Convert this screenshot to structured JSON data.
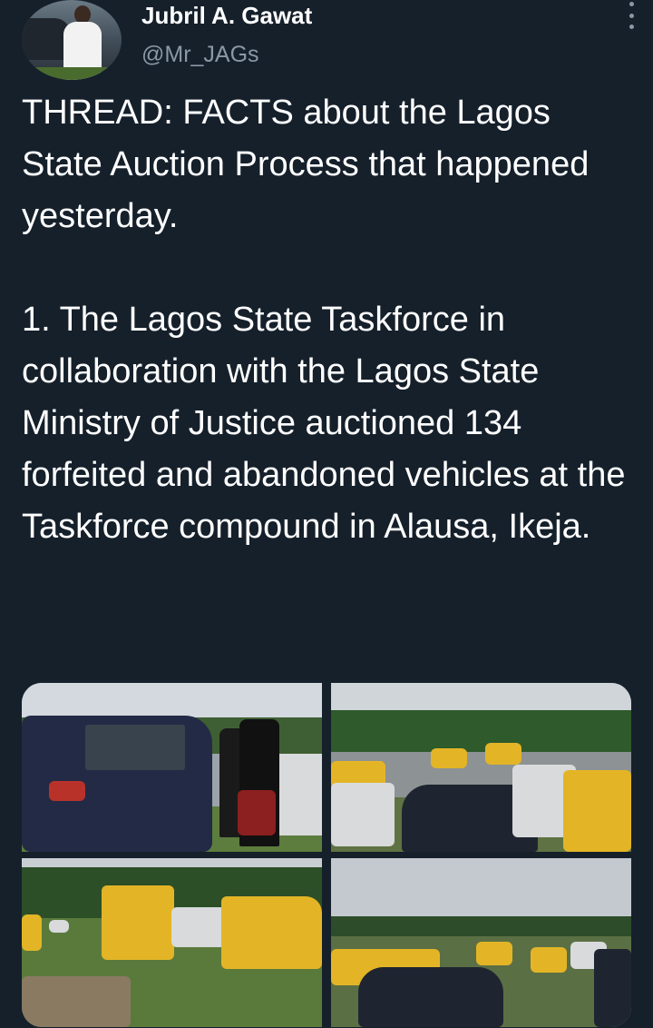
{
  "author": {
    "name": "Jubril A. Gawat",
    "handle": "@Mr_JAGs"
  },
  "tweet": {
    "paragraph1": "THREAD: FACTS about the Lagos State Auction Process that happened yesterday.",
    "paragraph2": "1. The Lagos State Taskforce in collaboration with the Lagos State Ministry of Justice auctioned 134 forfeited and abandoned vehicles at the Taskforce compound in Alausa, Ikeja."
  },
  "media": {
    "count": 4,
    "photos": [
      "Vehicles at auction 1",
      "Vehicles at auction 2",
      "Vehicles at auction 3",
      "Vehicles at auction 4"
    ]
  },
  "icons": {
    "more": "more-vertical-icon"
  },
  "colors": {
    "background": "#15202b",
    "text": "#ffffff",
    "secondary_text": "#8b98a5"
  }
}
